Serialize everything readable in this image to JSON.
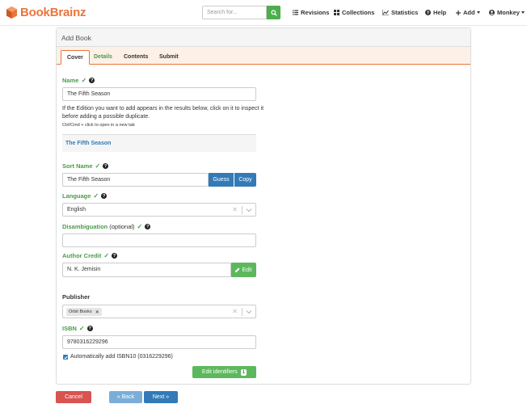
{
  "navbar": {
    "brand": "BookBrainz",
    "search_placeholder": "Search for...",
    "items": {
      "revisions": "Revisions",
      "collections": "Collections",
      "statistics": "Statistics",
      "help": "Help",
      "add": "Add",
      "user": "Monkey"
    }
  },
  "panel": {
    "title": "Add Book",
    "tabs": [
      "Cover",
      "Details",
      "Contents",
      "Submit"
    ]
  },
  "form": {
    "name_label": "Name",
    "name_value": "The Fifth Season",
    "duplicate_note": "If the Edition you want to add appears in the results below, click on it to inspect it before adding a possible duplicate.",
    "duplicate_hint": "Ctrl/Cmd + click to open in a new tab",
    "duplicate_result": "The Fifth Season",
    "sort_name_label": "Sort Name",
    "sort_name_value": "The Fifth Season",
    "guess_button": "Guess",
    "copy_button": "Copy",
    "language_label": "Language",
    "language_value": "English",
    "disambiguation_label": "Disambiguation",
    "disambiguation_optional": "(optional)",
    "author_credit_label": "Author Credit",
    "author_credit_value": "N. K. Jemisin",
    "edit_button": "Edit",
    "publisher_label": "Publisher",
    "publisher_value": "Orbit Books",
    "isbn_label": "ISBN",
    "isbn_value": "9780316229296",
    "auto_isbn_label": "Automatically add ISBN10 (0316229296)",
    "auto_isbn_checked": true,
    "edit_identifiers_button": "Edit identifiers",
    "identifiers_count": "1"
  },
  "footer": {
    "cancel": "Cancel",
    "back": "« Back",
    "next": "Next »"
  },
  "colors": {
    "brand": "#eb743b",
    "valid": "#4a9b4a",
    "primary": "#337ab7",
    "success": "#5cb85c",
    "danger": "#d9534f"
  }
}
